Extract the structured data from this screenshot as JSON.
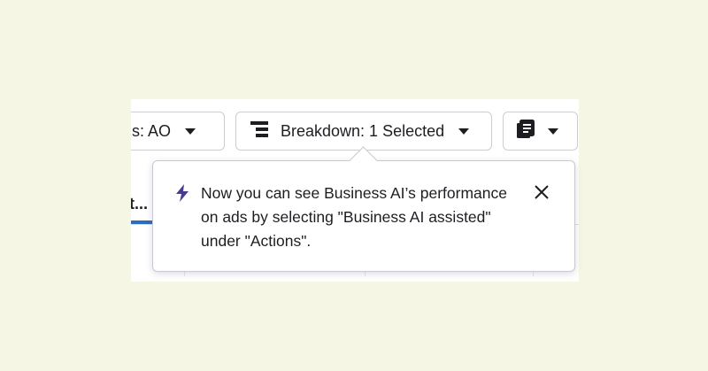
{
  "toolbar": {
    "columns_label": "nns: AO",
    "breakdown_label": "Breakdown: 1 Selected",
    "reports_icon": "report-stack-icon"
  },
  "table": {
    "header_text": "t..."
  },
  "tooltip": {
    "icon": "lightning-bolt-icon",
    "message": "Now you can see Business AI’s performance on ads by selecting \"Business AI assisted\" under \"Actions\".",
    "close_icon": "close-icon"
  },
  "colors": {
    "background": "#f5f6e3",
    "bolt": "#4b3b8f",
    "accent_underline": "#2d6db5"
  }
}
